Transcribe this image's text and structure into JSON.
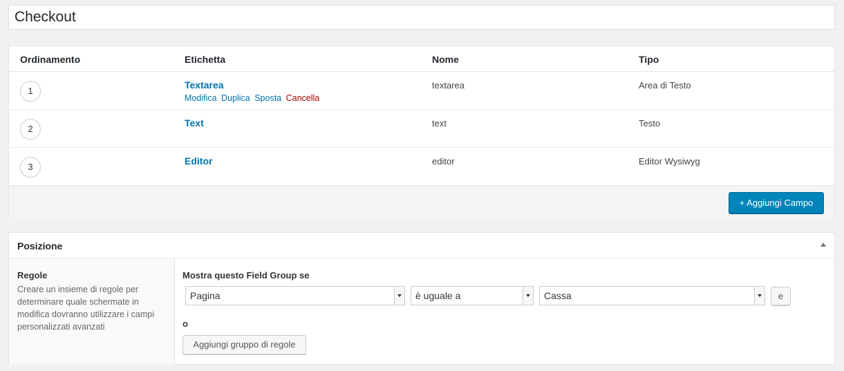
{
  "page": {
    "title": "Checkout"
  },
  "fields_table": {
    "headers": {
      "order": "Ordinamento",
      "label": "Etichetta",
      "name": "Nome",
      "type": "Tipo"
    },
    "rows": [
      {
        "order": "1",
        "label": "Textarea",
        "name": "textarea",
        "type": "Area di Testo"
      },
      {
        "order": "2",
        "label": "Text",
        "name": "text",
        "type": "Testo"
      },
      {
        "order": "3",
        "label": "Editor",
        "name": "editor",
        "type": "Editor Wysiwyg"
      }
    ],
    "row_actions": {
      "edit": "Modifica",
      "duplicate": "Duplica",
      "move": "Sposta",
      "delete": "Cancella"
    },
    "add_button": "+ Aggiungi Campo"
  },
  "location": {
    "title": "Posizione",
    "rules_title": "Regole",
    "rules_description": "Creare un insieme di regole per determinare quale schermate in modifica dovranno utilizzare i campi personalizzati avanzati",
    "show_if_label": "Mostra questo Field Group se",
    "rule": {
      "param": "Pagina",
      "operator": "è uguale a",
      "value": "Cassa"
    },
    "and_button": "e",
    "or_label": "o",
    "add_group_button": "Aggiungi gruppo di regole"
  },
  "colors": {
    "link": "#0073aa",
    "delete": "#a00000",
    "primary_button": "#0085ba"
  },
  "icons": {
    "collapse": "triangle-up-icon",
    "dropdown": "chevron-down-icon"
  }
}
